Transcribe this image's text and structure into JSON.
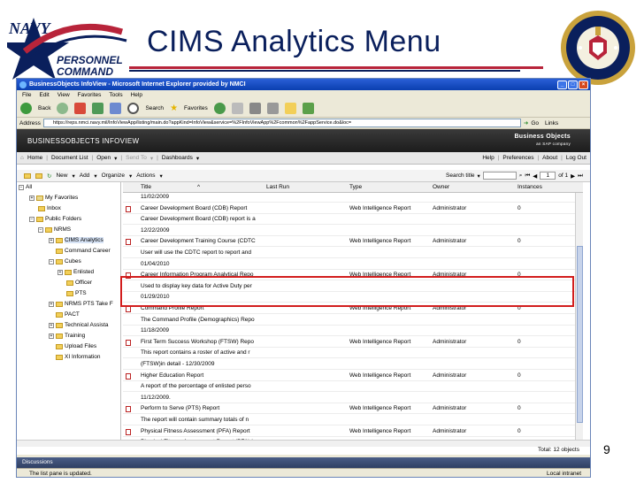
{
  "slide": {
    "title": "CIMS Analytics Menu",
    "page_number": "9",
    "logo_text": [
      "NAVY",
      "PERSONNEL",
      "COMMAND"
    ],
    "seal_text": "UNITED STATES NAVY · NAVY PERSONNEL COMMAND"
  },
  "browser": {
    "title": "BusinessObjects InfoView - Microsoft Internet Explorer provided by NMCI",
    "menu": [
      "File",
      "Edit",
      "View",
      "Favorites",
      "Tools",
      "Help"
    ],
    "toolbar": {
      "back": "Back",
      "search": "Search",
      "favorites": "Favorites"
    },
    "address_label": "Address",
    "address_value": "https://reps.nmci.navy.mil/InfoViewApp/listing/main.do?appKind=InfoView&service=%2FInfoViewApp%2Fcommon%2FappService.do&loc=",
    "go_label": "Go",
    "links_label": "Links",
    "status": "The list pane is updated.",
    "zone": "Local intranet"
  },
  "bo": {
    "header_title": "BUSINESSOBJECTS INFOVIEW",
    "brand": "Business Objects",
    "brand_sub": "an SAP company",
    "nav": {
      "home": "Home",
      "document_list": "Document List",
      "open": "Open",
      "send_to": "Send To",
      "dashboards": "Dashboards",
      "help": "Help",
      "preferences": "Preferences",
      "about": "About",
      "logout": "Log Out"
    },
    "workspace_toolbar": {
      "new": "New",
      "add": "Add",
      "organize": "Organize",
      "actions": "Actions",
      "search_title": "Search title",
      "page_current": "1",
      "page_of": "of 1"
    },
    "tree": [
      {
        "label": "All",
        "depth": 0
      },
      {
        "label": "My Favorites",
        "depth": 1
      },
      {
        "label": "Inbox",
        "depth": 1
      },
      {
        "label": "Public Folders",
        "depth": 1
      },
      {
        "label": "NRMS",
        "depth": 2
      },
      {
        "label": "CIMS Analytics",
        "depth": 3
      },
      {
        "label": "Command Career",
        "depth": 3
      },
      {
        "label": "Cubes",
        "depth": 3
      },
      {
        "label": "Enlisted",
        "depth": 4
      },
      {
        "label": "Officer",
        "depth": 4
      },
      {
        "label": "PTS",
        "depth": 4
      },
      {
        "label": "NRMS PTS Take F",
        "depth": 3
      },
      {
        "label": "PACT",
        "depth": 3
      },
      {
        "label": "Technical Assista",
        "depth": 3
      },
      {
        "label": "Training",
        "depth": 3
      },
      {
        "label": "Upload Files",
        "depth": 3
      },
      {
        "label": "XI Information",
        "depth": 3
      }
    ],
    "columns": [
      "Title",
      "Last Run",
      "Type",
      "Owner",
      "Instances"
    ],
    "rows": [
      {
        "title": "11/02/2009",
        "last_run": "",
        "type": "",
        "owner": "",
        "instances": "",
        "icon": false
      },
      {
        "title": "Career Development Board (CDB) Report",
        "last_run": "",
        "type": "Web Intelligence Report",
        "owner": "Administrator",
        "instances": "0",
        "icon": true
      },
      {
        "title": "Career Development Board (CDB) report is a",
        "last_run": "",
        "type": "",
        "owner": "",
        "instances": "",
        "icon": false
      },
      {
        "title": "12/22/2009",
        "last_run": "",
        "type": "",
        "owner": "",
        "instances": "",
        "icon": false
      },
      {
        "title": "Career Development Training Course (CDTC",
        "last_run": "",
        "type": "Web Intelligence Report",
        "owner": "Administrator",
        "instances": "0",
        "icon": true
      },
      {
        "title": "User will use the CDTC report to report and",
        "last_run": "",
        "type": "",
        "owner": "",
        "instances": "",
        "icon": false
      },
      {
        "title": "01/04/2010",
        "last_run": "",
        "type": "",
        "owner": "",
        "instances": "",
        "icon": false
      },
      {
        "title": "Career Information Program Analytical Repo",
        "last_run": "",
        "type": "Web Intelligence Report",
        "owner": "Administrator",
        "instances": "0",
        "icon": true
      },
      {
        "title": "Used to display key data for Active Duty per",
        "last_run": "",
        "type": "",
        "owner": "",
        "instances": "",
        "icon": false
      },
      {
        "title": "01/29/2010",
        "last_run": "",
        "type": "",
        "owner": "",
        "instances": "",
        "icon": false
      },
      {
        "title": "Command Profile Report",
        "last_run": "",
        "type": "Web Intelligence Report",
        "owner": "Administrator",
        "instances": "0",
        "icon": true
      },
      {
        "title": "The Command Profile (Demographics) Repo",
        "last_run": "",
        "type": "",
        "owner": "",
        "instances": "",
        "icon": false
      },
      {
        "title": "11/18/2009",
        "last_run": "",
        "type": "",
        "owner": "",
        "instances": "",
        "icon": false
      },
      {
        "title": "First Term Success Workshop (FTSW) Repo",
        "last_run": "",
        "type": "Web Intelligence Report",
        "owner": "Administrator",
        "instances": "0",
        "icon": true
      },
      {
        "title": "This report contains a roster of active and r",
        "last_run": "",
        "type": "",
        "owner": "",
        "instances": "",
        "icon": false
      },
      {
        "title": "(FTSW)in detail - 12/30/2009",
        "last_run": "",
        "type": "",
        "owner": "",
        "instances": "",
        "icon": false
      },
      {
        "title": "Higher Education Report",
        "last_run": "",
        "type": "Web Intelligence Report",
        "owner": "Administrator",
        "instances": "0",
        "icon": true
      },
      {
        "title": "A report of the percentage of enlisted perso",
        "last_run": "",
        "type": "",
        "owner": "",
        "instances": "",
        "icon": false
      },
      {
        "title": "11/12/2009.",
        "last_run": "",
        "type": "",
        "owner": "",
        "instances": "",
        "icon": false
      },
      {
        "title": "Perform to Serve (PTS) Report",
        "last_run": "",
        "type": "Web Intelligence Report",
        "owner": "Administrator",
        "instances": "0",
        "icon": true
      },
      {
        "title": "The report will contain summary totals of n",
        "last_run": "",
        "type": "",
        "owner": "",
        "instances": "",
        "icon": false
      },
      {
        "title": "Physical Fitness Assessment (PFA) Report",
        "last_run": "",
        "type": "Web Intelligence Report",
        "owner": "Administrator",
        "instances": "0",
        "icon": true
      },
      {
        "title": "Physical Fitness Assessment Report (PFA) is",
        "last_run": "",
        "type": "",
        "owner": "",
        "instances": "",
        "icon": false
      }
    ],
    "total": "Total: 12 objects",
    "discussions": "Discussions"
  },
  "colors": {
    "navy": "#0a1f5c",
    "red": "#b8243a",
    "highlight": "#d21d1d"
  }
}
